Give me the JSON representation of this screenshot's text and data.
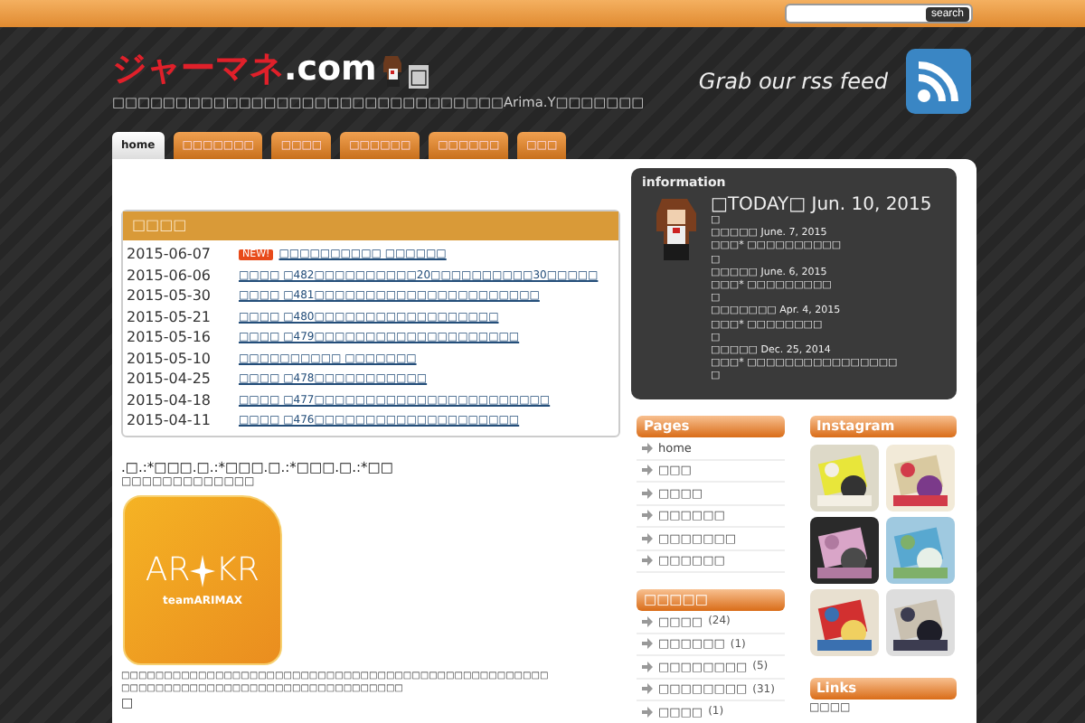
{
  "search": {
    "button": "search"
  },
  "header": {
    "logo_red": "ジャーマネ",
    "logo_white": ".com",
    "logo_after": "□",
    "subtitle": "□□□□□□□□□□□□□□□□□□□□□□□□□□□□□□□Arima.Y□□□□□□□",
    "rss": "Grab our rss feed"
  },
  "nav": [
    {
      "label": "home",
      "selected": true
    },
    {
      "label": "□□□□□□□",
      "selected": false
    },
    {
      "label": "□□□□",
      "selected": false
    },
    {
      "label": "□□□□□□",
      "selected": false
    },
    {
      "label": "□□□□□□",
      "selected": false
    },
    {
      "label": "□□□",
      "selected": false
    }
  ],
  "news": {
    "title": "□□□□",
    "rows": [
      {
        "date": "2015-06-07",
        "new": true,
        "badge": "NEW!",
        "title": "□□□□□□□□□□ □□□□□□"
      },
      {
        "date": "2015-06-06",
        "new": false,
        "title": "□□□□ □482□□□□□□□□□□20□□□□□□□□□□30□□□□□"
      },
      {
        "date": "2015-05-30",
        "new": false,
        "title": "□□□□ □481□□□□□□□□□□□□□□□□□□□□□□"
      },
      {
        "date": "2015-05-21",
        "new": false,
        "title": "□□□□ □480□□□□□□□□□□□□□□□□□□"
      },
      {
        "date": "2015-05-16",
        "new": false,
        "title": "□□□□ □479□□□□□□□□□□□□□□□□□□□□"
      },
      {
        "date": "2015-05-10",
        "new": false,
        "title": "□□□□□□□□□□ □□□□□□□"
      },
      {
        "date": "2015-04-25",
        "new": false,
        "title": "□□□□ □478□□□□□□□□□□□"
      },
      {
        "date": "2015-04-18",
        "new": false,
        "title": "□□□□ □477□□□□□□□□□□□□□□□□□□□□□□□"
      },
      {
        "date": "2015-04-11",
        "new": false,
        "title": "□□□□ □476□□□□□□□□□□□□□□□□□□□□"
      }
    ]
  },
  "post": {
    "title": ".□.:*□□□.□.:*□□□.□.:*□□□.□.:*□□",
    "subtitle": "□□□□□□□□□□□□□",
    "logo": {
      "left": "AR",
      "right": "KR",
      "team": "teamARIMAX"
    },
    "body": [
      "□□□□□□□□□□□□□□□□□□□□□□□□□□□□□□□□□□□□□□□□□□□□□□□□□□",
      "□□□□□□□□□□□□□□□□□□□□□□□□□□□□□□□□□",
      "□"
    ]
  },
  "information": {
    "title": "information",
    "today": "□TODAY□ Jun. 10, 2015",
    "lines": [
      "□",
      "□□□□□ June. 7, 2015",
      "□□□* □□□□□□□□□□",
      "□",
      "□□□□□ June. 6, 2015",
      "□□□* □□□□□□□□□",
      "□",
      "□□□□□□□ Apr. 4, 2015",
      "□□□* □□□□□□□□",
      "□",
      "□□□□□ Dec. 25, 2014",
      "□□□* □□□□□□□□□□□□□□□□",
      "□"
    ]
  },
  "pages": {
    "title": "Pages",
    "items": [
      "home",
      "□□□",
      "□□□□",
      "□□□□□□",
      "□□□□□□□",
      "□□□□□□"
    ]
  },
  "categories": {
    "title": "□□□□□",
    "items": [
      {
        "name": "□□□□",
        "count": "(24)"
      },
      {
        "name": "□□□□□□",
        "count": "(1)"
      },
      {
        "name": "□□□□□□□□",
        "count": "(5)"
      },
      {
        "name": "□□□□□□□□",
        "count": "(31)"
      },
      {
        "name": "□□□□",
        "count": "(1)"
      }
    ]
  },
  "instagram": {
    "title": "Instagram"
  },
  "links": {
    "title": "Links",
    "items": [
      "□□□□"
    ]
  }
}
